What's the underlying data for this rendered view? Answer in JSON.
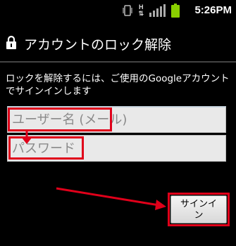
{
  "status_bar": {
    "time": "5:26PM",
    "network_label": "H",
    "icons": [
      "vibrate-icon",
      "data-arrows-icon",
      "signal-icon",
      "battery-icon"
    ],
    "battery_color": "#8ad000"
  },
  "header": {
    "title": "アカウントのロック解除",
    "icon": "lock-icon"
  },
  "form": {
    "description": "ロックを解除するには、ご使用のGoogleアカウントでサインインします",
    "username_placeholder": "ユーザー名 (メール)",
    "password_placeholder": "パスワード",
    "signin_label": "サインイン"
  },
  "annotations": {
    "highlight_color": "#e0001a"
  }
}
